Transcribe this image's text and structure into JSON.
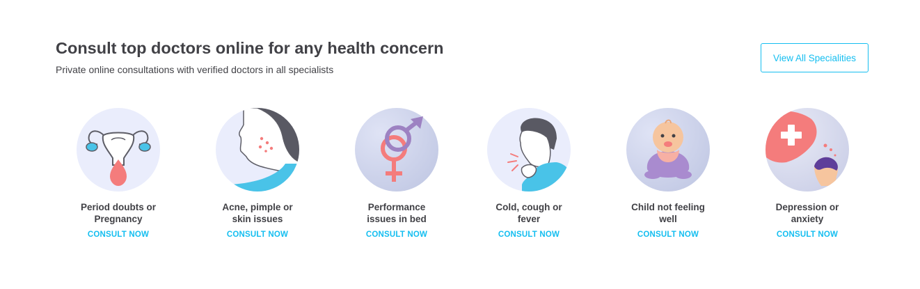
{
  "header": {
    "title": "Consult top doctors online for any health concern",
    "subtitle": "Private online consultations with verified doctors in all specialists",
    "view_all_label": "View All Specialities"
  },
  "specialties": [
    {
      "name": "Period doubts or\nPregnancy",
      "cta": "CONSULT NOW",
      "icon": "uterus-icon"
    },
    {
      "name": "Acne, pimple or\nskin issues",
      "cta": "CONSULT NOW",
      "icon": "acne-face-icon"
    },
    {
      "name": "Performance\nissues in bed",
      "cta": "CONSULT NOW",
      "icon": "gender-symbols-icon"
    },
    {
      "name": "Cold, cough or\nfever",
      "cta": "CONSULT NOW",
      "icon": "coughing-person-icon"
    },
    {
      "name": "Child not feeling\nwell",
      "cta": "CONSULT NOW",
      "icon": "baby-icon"
    },
    {
      "name": "Depression or\nanxiety",
      "cta": "CONSULT NOW",
      "icon": "mental-health-icon"
    }
  ],
  "colors": {
    "accent": "#14bef0",
    "text": "#414146"
  }
}
